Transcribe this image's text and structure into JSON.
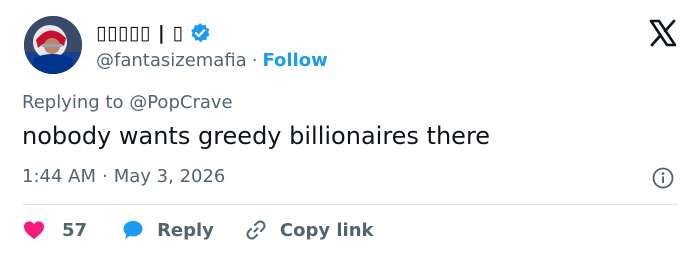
{
  "author": {
    "display_name": "▯▯▯▯▯ | ▯",
    "handle": "@fantasizemafia",
    "separator": "·",
    "follow_label": "Follow"
  },
  "reply_context": {
    "prefix": "Replying to",
    "mention": "@PopCrave"
  },
  "tweet": {
    "text": "nobody wants greedy billionaires there",
    "time": "1:44 AM",
    "separator": "·",
    "date": "May 3, 2026"
  },
  "actions": {
    "like_count": "57",
    "reply_label": "Reply",
    "copy_link_label": "Copy link"
  },
  "colors": {
    "accent": "#1d9bf0",
    "like": "#f91880",
    "text_primary": "#0f1419",
    "text_secondary": "#536471"
  },
  "icons": [
    "verified-badge-icon",
    "x-logo-icon",
    "info-icon",
    "heart-icon",
    "speech-bubble-icon",
    "link-icon"
  ]
}
